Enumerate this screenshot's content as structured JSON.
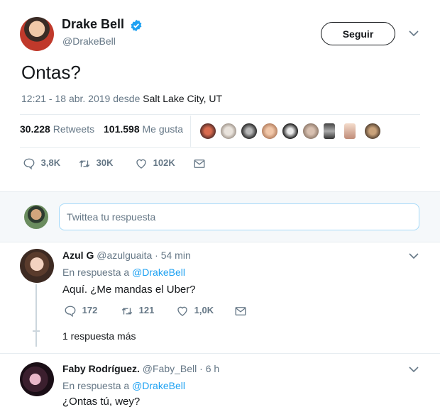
{
  "tweet": {
    "author_name": "Drake Bell",
    "author_handle": "@DrakeBell",
    "follow_label": "Seguir",
    "text": "Ontas?",
    "time_date": "12:21 - 18 abr. 2019 desde ",
    "location": "Salt Lake City, UT",
    "retweets_count": "30.228",
    "retweets_label": "Retweets",
    "likes_count": "101.598",
    "likes_label": "Me gusta",
    "actions": {
      "replies": "3,8K",
      "retweets": "30K",
      "likes": "102K"
    }
  },
  "reply_composer": {
    "placeholder": "Twittea tu respuesta"
  },
  "replies": [
    {
      "name": "Azul G",
      "handle": "@azulguaita",
      "time": "· 54 min",
      "in_reply_prefix": "En respuesta a ",
      "in_reply_handle": "@DrakeBell",
      "text": "Aquí. ¿Me mandas el Uber?",
      "actions": {
        "replies": "172",
        "retweets": "121",
        "likes": "1,0K"
      },
      "more_replies": "1 respuesta más"
    },
    {
      "name": "Faby Rodríguez.",
      "handle": "@Faby_Bell",
      "time": "· 6 h",
      "in_reply_prefix": "En respuesta a ",
      "in_reply_handle": "@DrakeBell",
      "text": "¿Ontas tú, wey?"
    }
  ],
  "colors": {
    "accent": "#1da1f2",
    "muted": "#657786",
    "divider": "#e6ecf0"
  }
}
